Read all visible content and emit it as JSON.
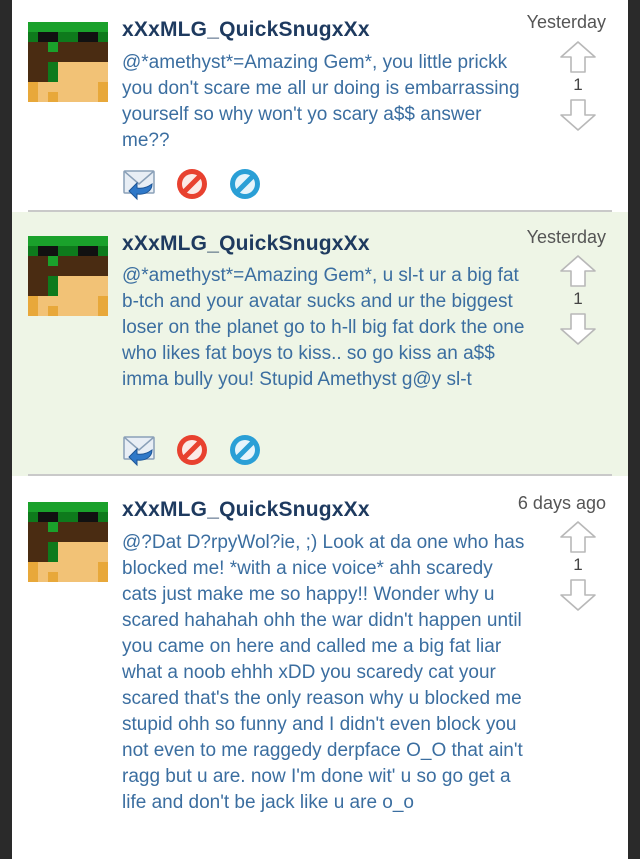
{
  "posts": [
    {
      "username": "xXxMLG_QuickSnugxXx",
      "timestamp": "Yesterday",
      "message": "@*amethyst*=Amazing Gem*, you little prickk you don't scare me all ur doing is embarrassing yourself so why won't yo scary a$$ answer me??",
      "votes": "1",
      "avatar_icon": "pixel-avatar-icon",
      "actions": [
        "reply-icon",
        "block-icon",
        "report-icon"
      ]
    },
    {
      "username": "xXxMLG_QuickSnugxXx",
      "timestamp": "Yesterday",
      "message": "@*amethyst*=Amazing Gem*, u sl-t ur a big fat b-tch and your avatar sucks and ur the biggest loser on the planet go to h-ll big fat dork the one who likes fat boys to kiss.. so go kiss an a$$ imma bully you! Stupid Amethyst g@y sl-t",
      "votes": "1",
      "avatar_icon": "pixel-avatar-icon",
      "actions": [
        "reply-icon",
        "block-icon",
        "report-icon"
      ]
    },
    {
      "username": "xXxMLG_QuickSnugxXx",
      "timestamp": "6 days ago",
      "message": "@?Dat D?rpyWol?ie, ;) Look at da one who has blocked me! *with a nice voice* ahh scaredy cats just make me so happy!! Wonder why u scared hahahah ohh the war didn't happen until you came on here and called me a big fat liar what a noob ehhh xDD you scaredy cat your scared that's the only reason why u blocked me stupid ohh so funny and I didn't even block you not even to me raggedy derpface O_O that ain't ragg but u are. now I'm done wit' u so go get a life and don't be jack like u are o_o",
      "votes": "1",
      "avatar_icon": "pixel-avatar-icon",
      "actions": []
    }
  ],
  "colors": {
    "username": "#1e3a5f",
    "message": "#3b6ea0",
    "highlight_bg": "#eef5e6",
    "block_red": "#e8412f",
    "report_blue": "#2a9fd6"
  }
}
